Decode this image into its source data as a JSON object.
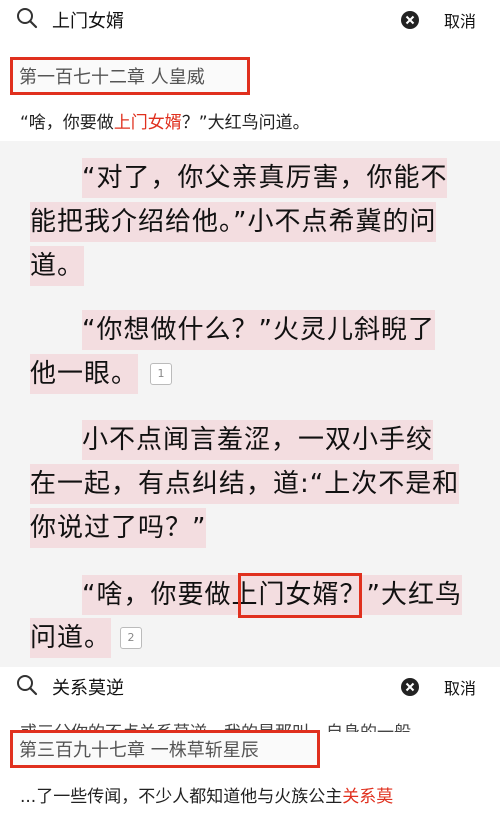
{
  "search1": {
    "query": "上门女婿",
    "cancel_label": "取消"
  },
  "result1": {
    "chapter_title": "第一百七十二章 人皇威",
    "snippet_before": "“啥，你要做",
    "snippet_hl": "上门女婿",
    "snippet_after": "？”大红鸟问道。"
  },
  "reader": {
    "lines": [
      "“对了，你父亲真厉害，你能不",
      "能把我介绍给他。”小不点希冀的问",
      "道。",
      "“你想做什么？”火灵儿斜睨了",
      "他一眼。",
      "小不点闻言羞涩，一双小手绞",
      "在一起，有点纠结，道:“上次不是和",
      "你说过了吗？”",
      "“啥，你要做上门女婿？”大红鸟",
      "问道。"
    ],
    "notes": [
      "1",
      "2"
    ]
  },
  "search2": {
    "query": "关系莫逆",
    "cancel_label": "取消"
  },
  "result2": {
    "cut_before": "或三分你的不点关系莫逆，我的是那叫，自身的一般",
    "cut_hl": "",
    "chapter_title": "第三百九十七章 一株草斩星辰",
    "snippet_before": "...了一些传闻，不少人都知道他与火族公主",
    "snippet_hl": "关系莫"
  },
  "colors": {
    "accent": "#e0301e",
    "highlight_bg": "#f3dde0",
    "page_bg": "#f4f4f4"
  },
  "icons": [
    "search-icon",
    "clear-icon",
    "note-icon"
  ]
}
